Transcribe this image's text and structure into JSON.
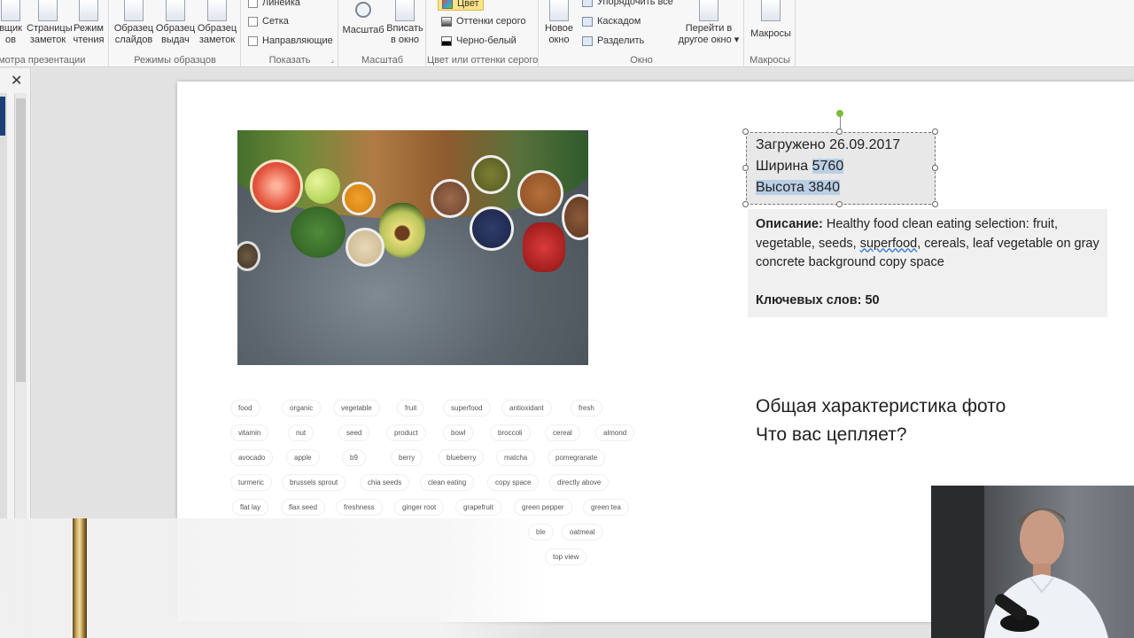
{
  "ribbon": {
    "group_view": {
      "buttons": [
        {
          "label1": "вщик",
          "label2": "ов"
        },
        {
          "label1": "Страницы",
          "label2": "заметок"
        },
        {
          "label1": "Режим",
          "label2": "чтения"
        }
      ],
      "label": "мотра презентации"
    },
    "group_master": {
      "buttons": [
        {
          "label1": "Образец",
          "label2": "слайдов"
        },
        {
          "label1": "Образец",
          "label2": "выдач"
        },
        {
          "label1": "Образец",
          "label2": "заметок"
        }
      ],
      "label": "Режимы образцов"
    },
    "group_show": {
      "items": [
        "Линейка",
        "Сетка",
        "Направляющие"
      ],
      "label": "Показать"
    },
    "group_zoom": {
      "buttons": [
        {
          "label1": "Масштаб",
          "label2": ""
        },
        {
          "label1": "Вписать",
          "label2": "в окно"
        }
      ],
      "label": "Масштаб"
    },
    "group_color": {
      "items": [
        "Цвет",
        "Оттенки серого",
        "Черно-белый"
      ],
      "label": "Цвет или оттенки серого"
    },
    "group_window": {
      "new_window": {
        "label1": "Новое",
        "label2": "окно"
      },
      "items": [
        "Упорядочить все",
        "Каскадом",
        "Разделить"
      ],
      "switch": {
        "label1": "Перейти в",
        "label2": "другое окно ▾"
      },
      "label": "Окно"
    },
    "group_macros": {
      "button": {
        "label1": "Макросы"
      },
      "label": "Макросы"
    }
  },
  "leftpane": {
    "close_glyph": "✕"
  },
  "slide": {
    "info": {
      "uploaded": "Загружено 26.09.2017",
      "width_label": "Ширина ",
      "width_value": "5760",
      "height_full": "Высота 3840"
    },
    "description": {
      "label": "Описание:",
      "text_before": " Healthy food clean eating selection: fruit, vegetable, seeds, ",
      "misspelled": "superfood",
      "text_after": ", cereals, leaf vegetable on gray concrete background copy space",
      "keywords_count": "Ключевых слов: 50"
    },
    "heading_1": "Общая характеристика фото",
    "heading_2": "Что вас цепляет?",
    "tags": [
      [
        "food",
        "organic",
        "vegetable",
        "fruit",
        "superfood",
        "antioxidant",
        "fresh"
      ],
      [
        "vitamin",
        "nut",
        "seed",
        "product",
        "bowl",
        "broccoli",
        "cereal",
        "almond"
      ],
      [
        "avocado",
        "apple",
        "b9",
        "berry",
        "blueberry",
        "matcha",
        "pomegranate"
      ],
      [
        "turmeric",
        "brussels sprout",
        "chia seeds",
        "clean eating",
        "copy space",
        "directly above"
      ],
      [
        "flat lay",
        "flax seed",
        "freshness",
        "ginger root",
        "grapefruit",
        "green pepper",
        "green tea"
      ],
      [
        "ble",
        "oatmeal"
      ],
      [
        "top view"
      ]
    ]
  },
  "colors": {
    "selection_highlight": "#b9cfe6",
    "rotation_handle": "#7dbb3b",
    "pane_selection": "#1c3f78",
    "spellcheck": "#3b7fd4"
  }
}
